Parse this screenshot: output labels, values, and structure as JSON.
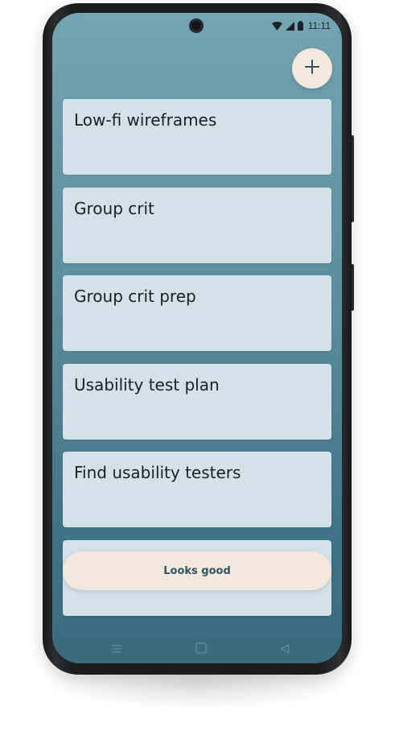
{
  "status_bar": {
    "time": "11:11",
    "icons": [
      "wifi-icon",
      "signal-icon",
      "battery-icon"
    ]
  },
  "fab": {
    "icon": "plus-icon",
    "color": "#f3e9dc"
  },
  "tasks": [
    {
      "title": "Low-fi wireframes"
    },
    {
      "title": "Group crit"
    },
    {
      "title": "Group crit prep"
    },
    {
      "title": "Usability test plan"
    },
    {
      "title": "Find usability testers"
    },
    {
      "title": ""
    }
  ],
  "confirm_button": {
    "label": "Looks good",
    "color": "#f2e8dd"
  },
  "nav_bar": {
    "icons": [
      "menu-icon",
      "home-icon",
      "back-icon"
    ]
  },
  "colors": {
    "screen_top": "#75a4b2",
    "screen_bottom": "#396b7d",
    "card": "#d3e2e9",
    "button_text": "#2f5565"
  }
}
